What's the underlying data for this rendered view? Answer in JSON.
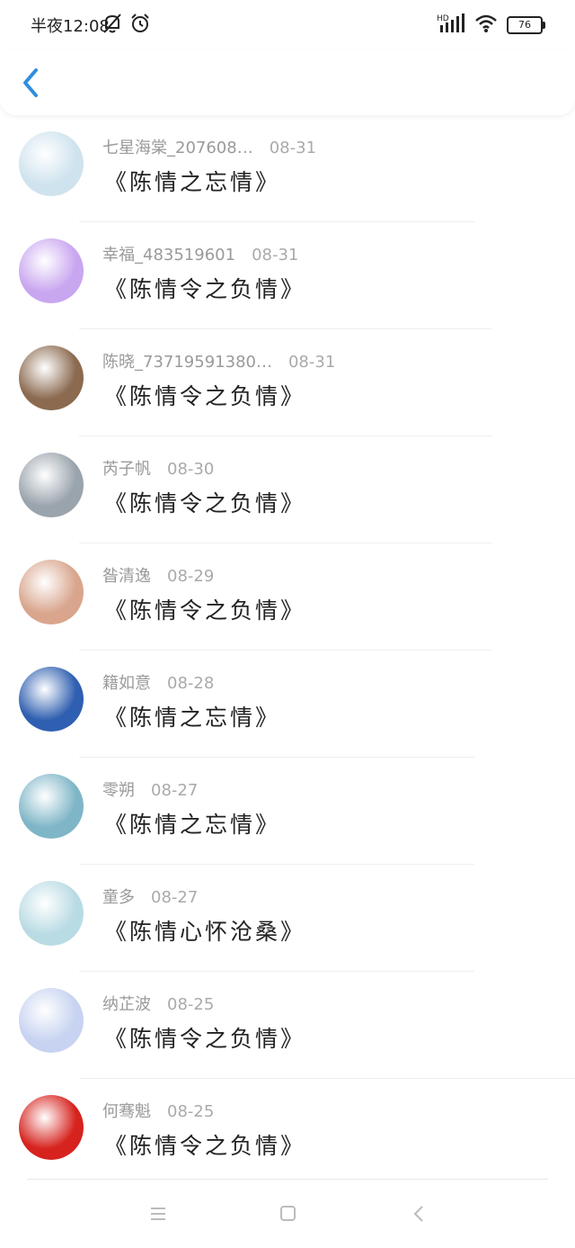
{
  "status_bar": {
    "time": "半夜12:08",
    "battery": "76",
    "signal_label": "HD"
  },
  "top_bar": {
    "back_icon": "chevron-left-icon"
  },
  "items": [
    {
      "name": "七星海棠_207608…",
      "date": "08-31",
      "message": "《陈情之忘情》",
      "avatar_color": "#cfe3ee"
    },
    {
      "name": "幸福_483519601",
      "date": "08-31",
      "message": "《陈情令之负情》",
      "avatar_color": "#c9a6f0"
    },
    {
      "name": "陈晓_73719591380…",
      "date": "08-31",
      "message": "《陈情令之负情》",
      "avatar_color": "#8b6a4f"
    },
    {
      "name": "芮子帆",
      "date": "08-30",
      "message": "《陈情令之负情》",
      "avatar_color": "#9aa4ad"
    },
    {
      "name": "昝清逸",
      "date": "08-29",
      "message": "《陈情令之负情》",
      "avatar_color": "#d9a58d"
    },
    {
      "name": "籍如意",
      "date": "08-28",
      "message": "《陈情之忘情》",
      "avatar_color": "#2f5fb0"
    },
    {
      "name": "零朔",
      "date": "08-27",
      "message": "《陈情之忘情》",
      "avatar_color": "#7fb6c7"
    },
    {
      "name": "童多",
      "date": "08-27",
      "message": "《陈情心怀沧桑》",
      "avatar_color": "#b9dbe4"
    },
    {
      "name": "纳芷波",
      "date": "08-25",
      "message": "《陈情令之负情》",
      "avatar_color": "#c7d3f1"
    },
    {
      "name": "何骞魁",
      "date": "08-25",
      "message": "《陈情令之负情》",
      "avatar_color": "#d6231e"
    }
  ],
  "nav_bar": {
    "menu_icon": "menu-icon",
    "home_icon": "square-home-icon",
    "back_icon": "triangle-back-icon"
  },
  "colors": {
    "accent": "#2f8ee0",
    "meta_text": "#9a9a9a",
    "divider": "#efefef"
  }
}
